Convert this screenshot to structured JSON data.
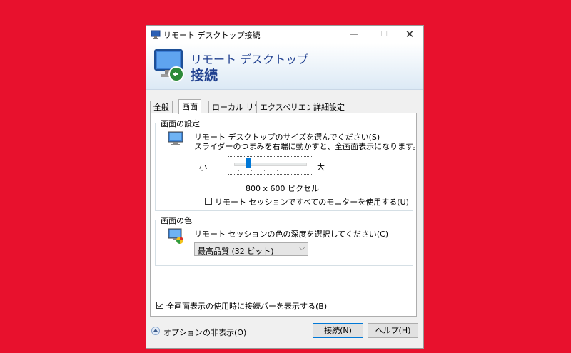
{
  "window": {
    "title": "リモート デスクトップ接続",
    "controls": {
      "minimize": "—",
      "maximize": "☐",
      "close": "✕"
    }
  },
  "banner": {
    "line1": "リモート デスクトップ",
    "line2": "接続"
  },
  "tabs": [
    {
      "label": "全般",
      "active": false
    },
    {
      "label": "画面",
      "active": true
    },
    {
      "label": "ローカル リソース",
      "active": false
    },
    {
      "label": "エクスペリエンス",
      "active": false
    },
    {
      "label": "詳細設定",
      "active": false
    }
  ],
  "display_settings": {
    "title": "画面の設定",
    "desc1": "リモート デスクトップのサイズを選んでください(S)",
    "desc2": "スライダーのつまみを右端に動かすと、全画面表示になります。",
    "small_label": "小",
    "large_label": "大",
    "slider_position": 0.2,
    "resolution": "800 x 600 ピクセル",
    "all_monitors_label": "リモート セッションですべてのモニターを使用する(U)",
    "all_monitors_checked": false
  },
  "colors": {
    "title": "画面の色",
    "desc": "リモート セッションの色の深度を選択してください(C)",
    "selected": "最高品質 (32 ビット)",
    "arrow": "⌵"
  },
  "connection_bar": {
    "label": "全画面表示の使用時に接続バーを表示する(B)",
    "checked": true
  },
  "footer": {
    "options_label": "オプションの非表示(O)",
    "connect_label": "接続(N)",
    "help_label": "ヘルプ(H)"
  }
}
